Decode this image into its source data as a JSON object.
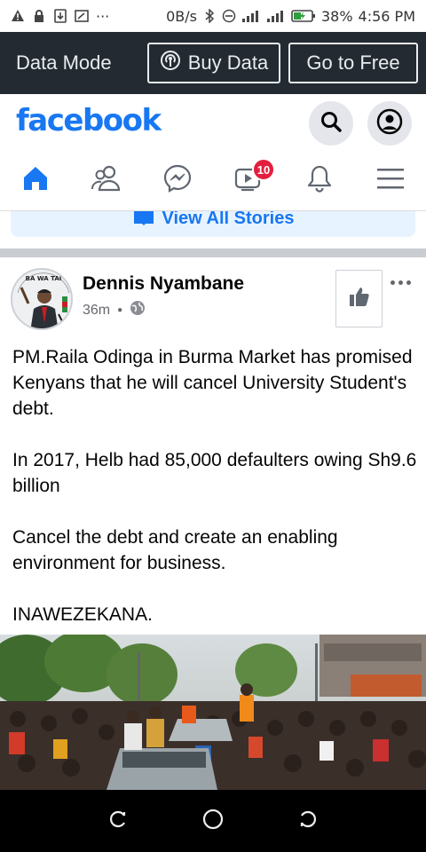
{
  "status_bar": {
    "net_speed": "0B/s",
    "battery": "38%",
    "time": "4:56 PM",
    "overflow": "···"
  },
  "data_mode": {
    "title": "Data Mode",
    "buy_label": "Buy Data",
    "free_label": "Go to Free"
  },
  "header": {
    "logo": "facebook",
    "brand_color": "#1877f2"
  },
  "nav": {
    "tabs": [
      {
        "name": "home",
        "icon": "home-icon",
        "active": true
      },
      {
        "name": "friends",
        "icon": "friends-icon"
      },
      {
        "name": "messenger",
        "icon": "messenger-icon"
      },
      {
        "name": "watch",
        "icon": "video-icon",
        "badge": "10"
      },
      {
        "name": "notifications",
        "icon": "bell-icon"
      },
      {
        "name": "menu",
        "icon": "hamburger-icon"
      }
    ]
  },
  "stories": {
    "label": "View All Stories"
  },
  "post": {
    "author": "Dennis Nyambane",
    "time": "36m",
    "avatar_text": "BA WA TAI",
    "paragraphs": [
      "PM.Raila Odinga in Burma Market has promised Kenyans that he will cancel University Student's debt.",
      "In 2017, Helb had 85,000 defaulters owing Sh9.6 billion",
      "Cancel the debt and create an enabling environment for business.",
      "INAWEZEKANA."
    ]
  }
}
